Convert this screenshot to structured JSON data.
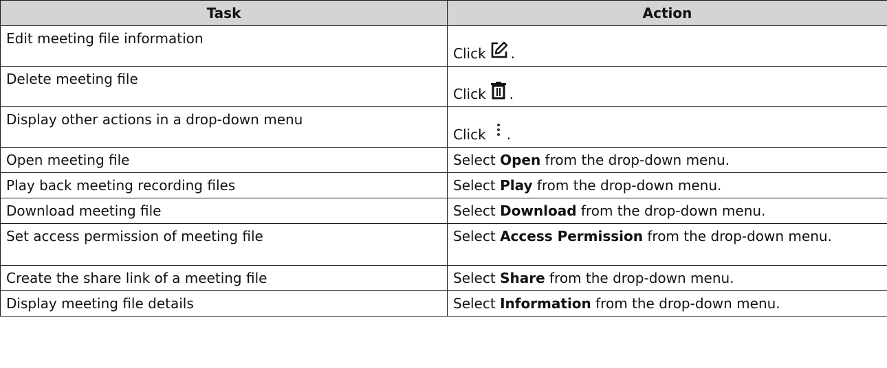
{
  "header": {
    "task": "Task",
    "action": "Action"
  },
  "rows": [
    {
      "task": "Edit meeting file information",
      "action_prefix": "Click",
      "icon": "edit-icon",
      "action_suffix": "."
    },
    {
      "task": "Delete meeting file",
      "action_prefix": "Click",
      "icon": "trash-icon",
      "action_suffix": "."
    },
    {
      "task": "Display other actions in a drop-down menu",
      "action_prefix": "Click",
      "icon": "more-vertical-icon",
      "action_suffix": "."
    },
    {
      "task": "Open meeting file",
      "action_prefix": "Select ",
      "bold": "Open",
      "action_suffix": " from the drop-down menu."
    },
    {
      "task": "Play back meeting recording files",
      "action_prefix": "Select ",
      "bold": "Play",
      "action_suffix": " from the drop-down menu."
    },
    {
      "task": "Download meeting file",
      "action_prefix": "Select ",
      "bold": "Download",
      "action_suffix": " from the drop-down menu."
    },
    {
      "task": "Set access permission of meeting file",
      "action_prefix": "Select ",
      "bold": "Access Permission",
      "action_suffix": " from the drop-down menu."
    },
    {
      "task": "Create the share link of a meeting file",
      "action_prefix": "Select ",
      "bold": "Share",
      "action_suffix": " from the drop-down menu."
    },
    {
      "task": "Display meeting file details",
      "action_prefix": "Select ",
      "bold": "Information",
      "action_suffix": " from the drop-down menu."
    }
  ]
}
